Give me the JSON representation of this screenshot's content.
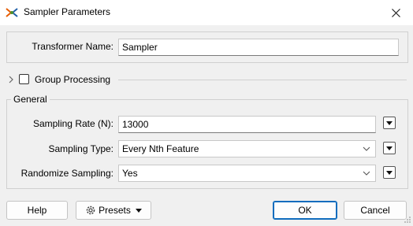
{
  "window": {
    "title": "Sampler Parameters",
    "close_icon": "close-icon"
  },
  "transformer": {
    "label": "Transformer Name:",
    "value": "Sampler"
  },
  "group_processing": {
    "label": "Group Processing",
    "checked": false
  },
  "general": {
    "title": "General",
    "sampling_rate": {
      "label": "Sampling Rate (N):",
      "value": "13000"
    },
    "sampling_type": {
      "label": "Sampling Type:",
      "value": "Every Nth Feature"
    },
    "randomize": {
      "label": "Randomize Sampling:",
      "value": "Yes"
    }
  },
  "buttons": {
    "help": "Help",
    "presets": "Presets",
    "ok": "OK",
    "cancel": "Cancel"
  },
  "colors": {
    "accent": "#0f6cbd",
    "background": "#f0f0f0"
  }
}
